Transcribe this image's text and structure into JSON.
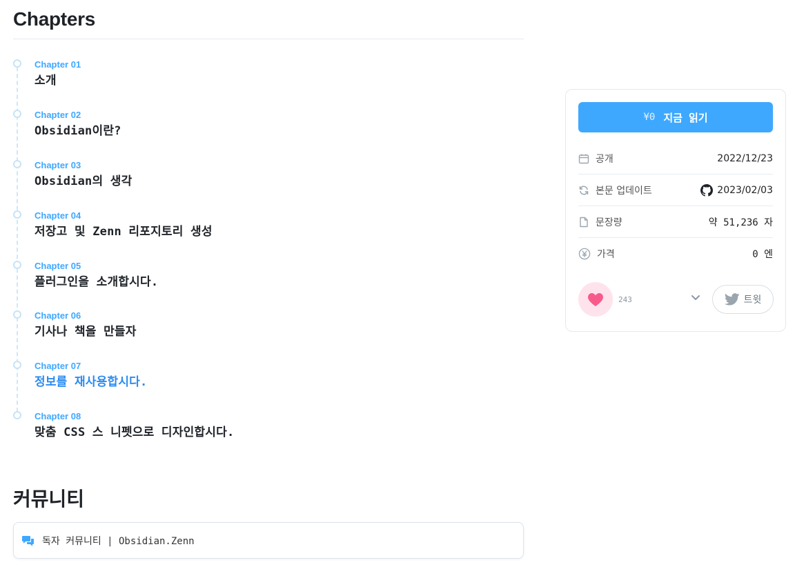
{
  "chapters_heading": "Chapters",
  "chapters": [
    {
      "number": "Chapter 01",
      "title": "소개"
    },
    {
      "number": "Chapter 02",
      "title": "Obsidian이란?"
    },
    {
      "number": "Chapter 03",
      "title": "Obsidian의 생각"
    },
    {
      "number": "Chapter 04",
      "title": "저장고 및 Zenn 리포지토리 생성"
    },
    {
      "number": "Chapter 05",
      "title": "플러그인을 소개합시다."
    },
    {
      "number": "Chapter 06",
      "title": "기사나 책을 만들자"
    },
    {
      "number": "Chapter 07",
      "title": "정보를 재사용합시다."
    },
    {
      "number": "Chapter 08",
      "title": "맞춤 CSS 스 니펫으로 디자인합시다."
    }
  ],
  "current_chapter": "Chapter 07",
  "community": {
    "heading": "커뮤니티",
    "link_text": "독자 커뮤니티 | Obsidian.Zenn",
    "icon": "chat-bubbles-icon"
  },
  "sidebar": {
    "read_button": {
      "price": "¥0",
      "label": "지금 읽기"
    },
    "meta": {
      "published": {
        "label": "공개",
        "value": "2022/12/23",
        "icon": "calendar-icon"
      },
      "updated": {
        "label": "본문 업데이트",
        "value": "2023/02/03",
        "icon": "refresh-icon",
        "value_icon": "github-icon"
      },
      "length": {
        "label": "문장량",
        "value": "약 51,236 자",
        "icon": "document-icon"
      },
      "price": {
        "label": "가격",
        "value": "0 엔",
        "icon": "yen-icon"
      }
    },
    "likes": "243",
    "tweet_label": "트윗"
  },
  "colors": {
    "accent": "#3ea8ff",
    "current_chapter": "#2a8bf2",
    "like_bg": "#ffe3ec",
    "like_heart": "#f85b8b"
  }
}
